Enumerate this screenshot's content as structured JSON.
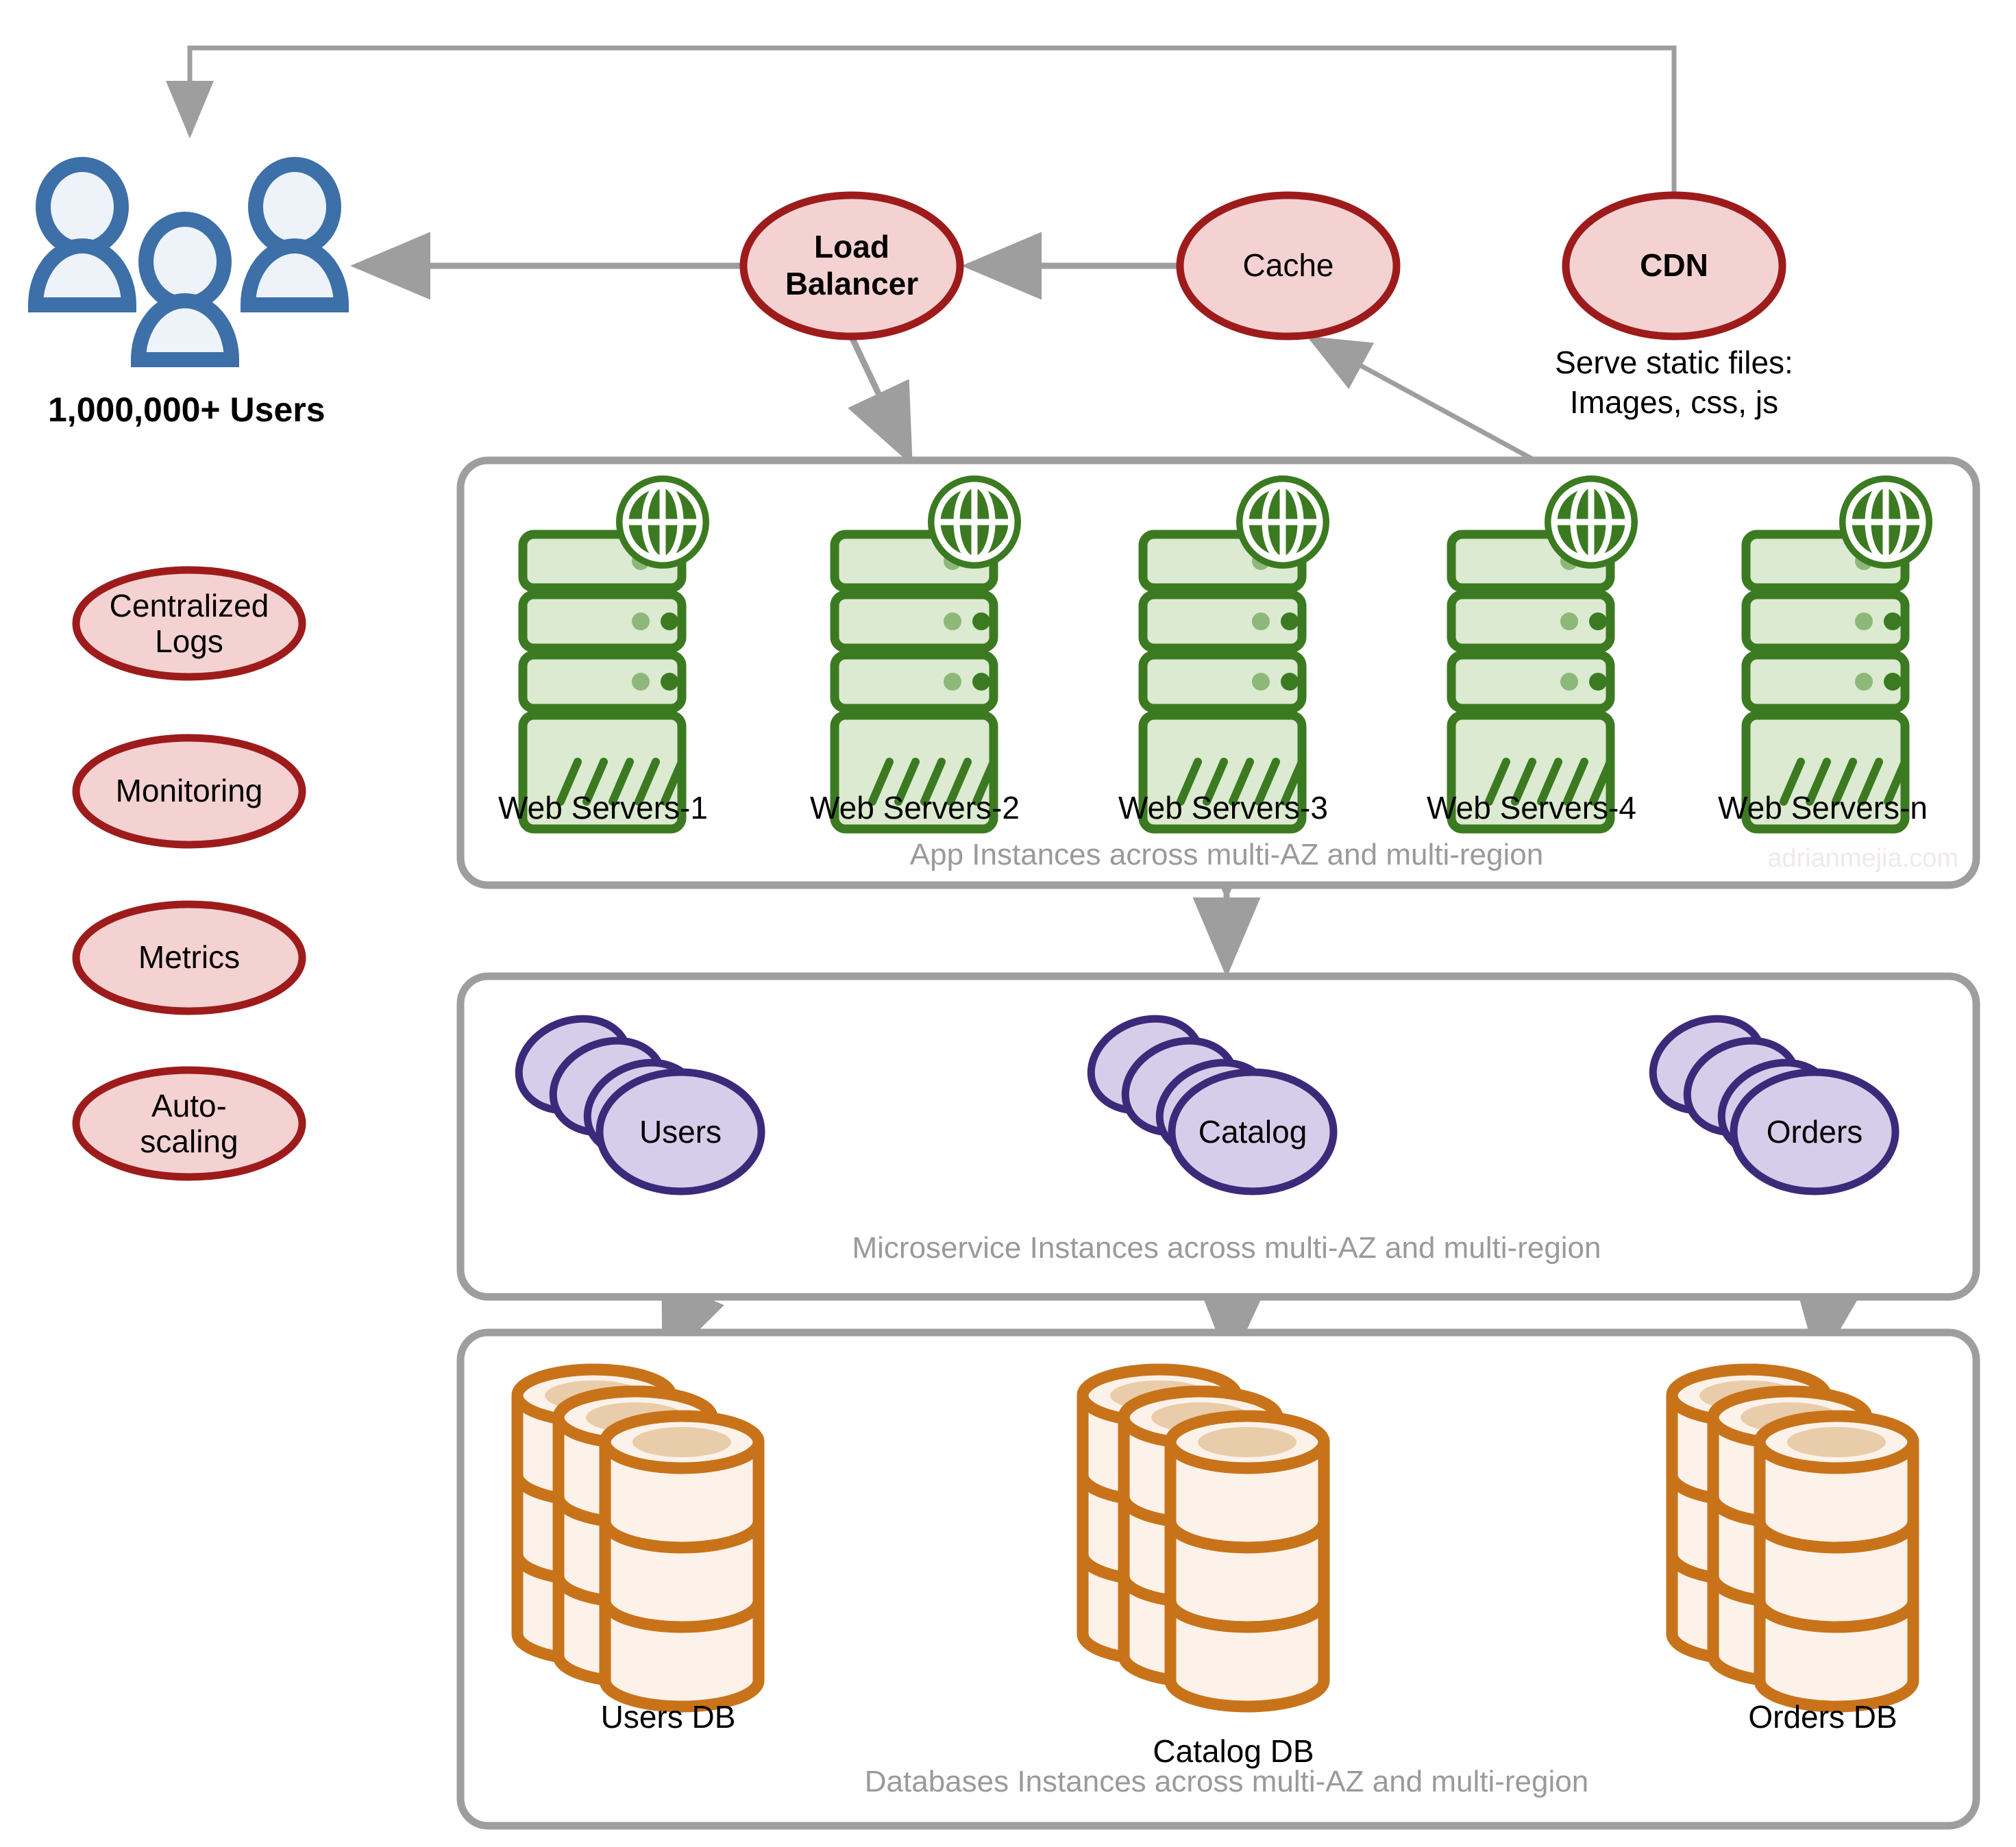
{
  "diagram": {
    "title": "Scalable web architecture: 1,000,000+ users",
    "watermark": "adrianmejia.com",
    "colors": {
      "node_fill": "#f5d2d2",
      "node_stroke": "#9e1b1b",
      "server_stroke": "#3c7a22",
      "server_fill": "#dbead0",
      "service_fill": "#d6cdea",
      "service_stroke": "#3b2a7a",
      "db_stroke": "#c8731a",
      "db_fill": "#fdf2ea",
      "db_top": "#e9cdaa",
      "user_stroke": "#3d6fa8",
      "user_fill": "#eef3f9",
      "connector": "#9e9e9e",
      "container_stroke": "#9e9e9e",
      "caption": "#9a9a9a"
    }
  },
  "users": {
    "label": "1,000,000+ Users",
    "icon": "users-group-icon"
  },
  "edge_nodes": [
    {
      "id": "load-balancer",
      "label_lines": [
        "Load",
        "Balancer"
      ],
      "bold": true
    },
    {
      "id": "cache",
      "label_lines": [
        "Cache"
      ],
      "bold": false
    },
    {
      "id": "cdn",
      "label_lines": [
        "CDN"
      ],
      "bold": true
    }
  ],
  "cdn_note": {
    "lines": [
      "Serve static files:",
      "Images, css, js"
    ]
  },
  "ops_nodes": [
    {
      "id": "centralized-logs",
      "label_lines": [
        "Centralized",
        "Logs"
      ]
    },
    {
      "id": "monitoring",
      "label_lines": [
        "Monitoring"
      ]
    },
    {
      "id": "metrics",
      "label_lines": [
        "Metrics"
      ]
    },
    {
      "id": "auto-scaling",
      "label_lines": [
        "Auto-",
        "scaling"
      ]
    }
  ],
  "app_tier": {
    "caption": "App Instances across multi-AZ and multi-region",
    "servers": [
      {
        "id": "web-servers-1",
        "label": "Web Servers-1"
      },
      {
        "id": "web-servers-2",
        "label": "Web Servers-2"
      },
      {
        "id": "web-servers-3",
        "label": "Web Servers-3"
      },
      {
        "id": "web-servers-4",
        "label": "Web Servers-4"
      },
      {
        "id": "web-servers-n",
        "label": "Web Servers-n"
      }
    ]
  },
  "service_tier": {
    "caption": "Microservice Instances across multi-AZ and multi-region",
    "services": [
      {
        "id": "users-service",
        "label": "Users"
      },
      {
        "id": "catalog-service",
        "label": "Catalog"
      },
      {
        "id": "orders-service",
        "label": "Orders"
      }
    ]
  },
  "data_tier": {
    "caption": "Databases Instances across multi-AZ and multi-region",
    "databases": [
      {
        "id": "users-db",
        "label": "Users DB"
      },
      {
        "id": "catalog-db",
        "label": "Catalog DB"
      },
      {
        "id": "orders-db",
        "label": "Orders DB"
      }
    ]
  }
}
